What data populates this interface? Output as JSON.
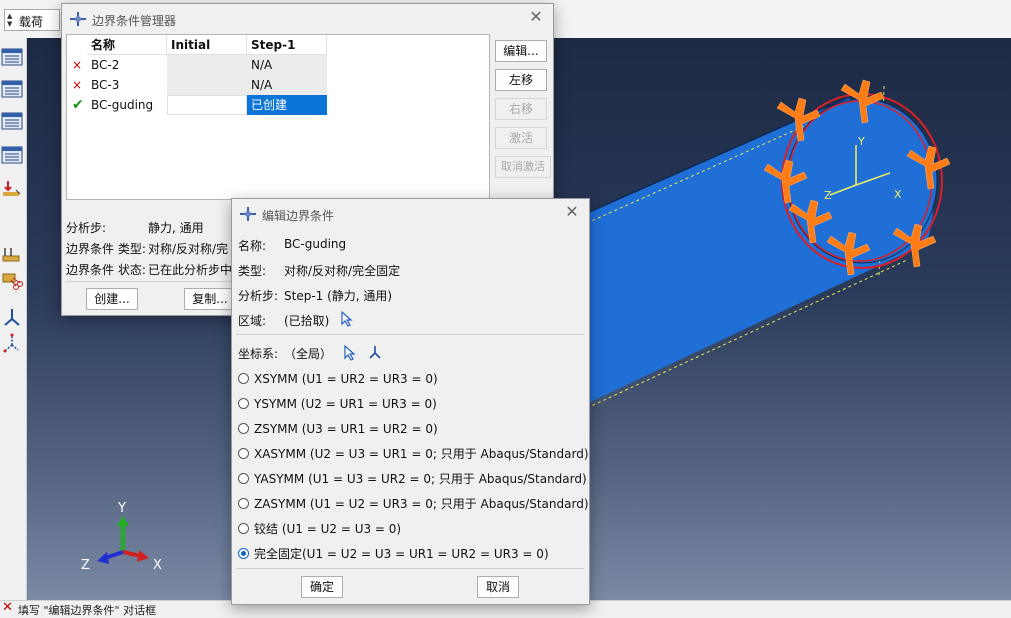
{
  "topbar": {
    "module_label": "载荷"
  },
  "manager": {
    "title": "边界条件管理器",
    "columns": [
      "名称",
      "Initial",
      "Step-1"
    ],
    "rows": [
      {
        "status": "×",
        "name": "BC-2",
        "initial": "",
        "step1": "N/A"
      },
      {
        "status": "×",
        "name": "BC-3",
        "initial": "",
        "step1": "N/A"
      },
      {
        "status": "✔",
        "name": "BC-guding",
        "initial": "",
        "step1": "已创建"
      }
    ],
    "buttons": {
      "edit": "编辑...",
      "move_left": "左移",
      "move_right": "右移",
      "activate": "激活",
      "deactivate": "取消激活"
    },
    "info": {
      "step_label": "分析步:",
      "step_value": "静力, 通用",
      "type_label": "边界条件 类型:",
      "type_value": "对称/反对称/完",
      "status_label": "边界条件 状态:",
      "status_value": "已在此分析步中"
    },
    "footer": {
      "create": "创建...",
      "copy": "复制..."
    }
  },
  "editor": {
    "title": "编辑边界条件",
    "name_label": "名称:",
    "name_value": "BC-guding",
    "type_label": "类型:",
    "type_value": "对称/反对称/完全固定",
    "step_label": "分析步:",
    "step_value": "Step-1 (静力, 通用)",
    "region_label": "区域:",
    "region_value": "(已拾取)",
    "csys_label": "坐标系:",
    "csys_value": "（全局）",
    "options": [
      {
        "label": "XSYMM (U1 = UR2 = UR3 = 0)",
        "selected": false
      },
      {
        "label": "YSYMM (U2 = UR1 = UR3 = 0)",
        "selected": false
      },
      {
        "label": "ZSYMM (U3 = UR1 = UR2 = 0)",
        "selected": false
      },
      {
        "label": "XASYMM (U2 = U3 = UR1 = 0; 只用于 Abaqus/Standard)",
        "selected": false
      },
      {
        "label": "YASYMM (U1 = U3 = UR2 = 0; 只用于 Abaqus/Standard)",
        "selected": false
      },
      {
        "label": "ZASYMM (U1 = U2 = UR3 = 0; 只用于 Abaqus/Standard)",
        "selected": false
      },
      {
        "label": "铰结 (U1 = U2 = U3 = 0)",
        "selected": false
      },
      {
        "label": "完全固定(U1 = U2 = U3 = UR1 = UR2 = UR3 = 0)",
        "selected": true
      }
    ],
    "ok": "确定",
    "cancel": "取消"
  },
  "viewport": {
    "triad": {
      "x": "X",
      "y": "Y",
      "z": "Z"
    },
    "local_triad": {
      "x": "X",
      "y": "Y",
      "z": "Z"
    }
  },
  "statusbar": {
    "message": "填写 \"编辑边界条件\" 对话框"
  },
  "colors": {
    "selection": "#0a74d8",
    "cylinder": "#1f6fd6",
    "marker": "#ff7d17",
    "edge": "#d8202a"
  }
}
